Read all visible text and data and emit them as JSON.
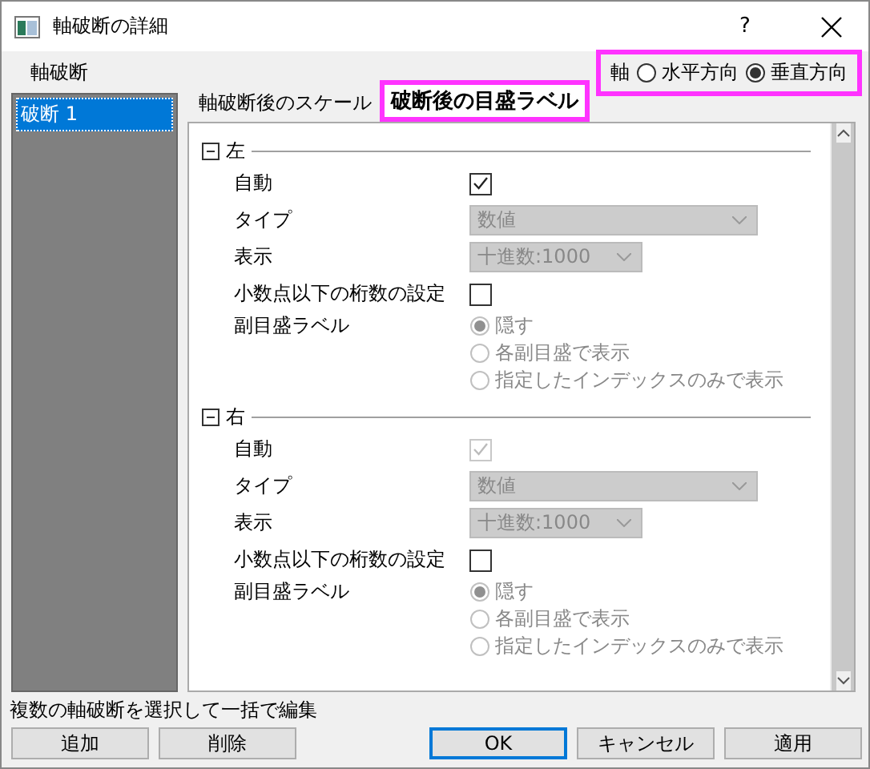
{
  "window": {
    "title": "軸破断の詳細",
    "help": "?"
  },
  "panel_label": "軸破断",
  "axis": {
    "label": "軸",
    "highlighted": true,
    "options": [
      {
        "label": "水平方向",
        "selected": false
      },
      {
        "label": "垂直方向",
        "selected": true
      }
    ]
  },
  "breaks": [
    {
      "label": "破断 1",
      "selected": true
    }
  ],
  "tabs": [
    {
      "label": "軸破断後のスケール",
      "selected": false,
      "highlighted": false
    },
    {
      "label": "破断後の目盛ラベル",
      "selected": true,
      "highlighted": true
    }
  ],
  "sections": [
    {
      "title": "左",
      "expanded": true,
      "auto": {
        "label": "自動",
        "checked": true,
        "disabled": false
      },
      "type": {
        "label": "タイプ",
        "value": "数値",
        "disabled": true
      },
      "display": {
        "label": "表示",
        "value": "十進数:1000",
        "disabled": true
      },
      "decimal": {
        "label": "小数点以下の桁数の設定",
        "checked": false
      },
      "minor": {
        "label": "副目盛ラベル",
        "disabled": true,
        "options": [
          {
            "label": "隠す",
            "selected": true
          },
          {
            "label": "各副目盛で表示",
            "selected": false
          },
          {
            "label": "指定したインデックスのみで表示",
            "selected": false
          }
        ]
      }
    },
    {
      "title": "右",
      "expanded": true,
      "auto": {
        "label": "自動",
        "checked": true,
        "disabled": true
      },
      "type": {
        "label": "タイプ",
        "value": "数値",
        "disabled": true
      },
      "display": {
        "label": "表示",
        "value": "十進数:1000",
        "disabled": true
      },
      "decimal": {
        "label": "小数点以下の桁数の設定",
        "checked": false
      },
      "minor": {
        "label": "副目盛ラベル",
        "disabled": true,
        "options": [
          {
            "label": "隠す",
            "selected": true
          },
          {
            "label": "各副目盛で表示",
            "selected": false
          },
          {
            "label": "指定したインデックスのみで表示",
            "selected": false
          }
        ]
      }
    }
  ],
  "hint": "複数の軸破断を選択して一括で編集",
  "left_buttons": [
    {
      "label": "追加",
      "default": false
    },
    {
      "label": "削除",
      "default": false
    }
  ],
  "right_buttons": [
    {
      "label": "OK",
      "default": true
    },
    {
      "label": "キャンセル",
      "default": false
    },
    {
      "label": "適用",
      "default": false
    }
  ]
}
